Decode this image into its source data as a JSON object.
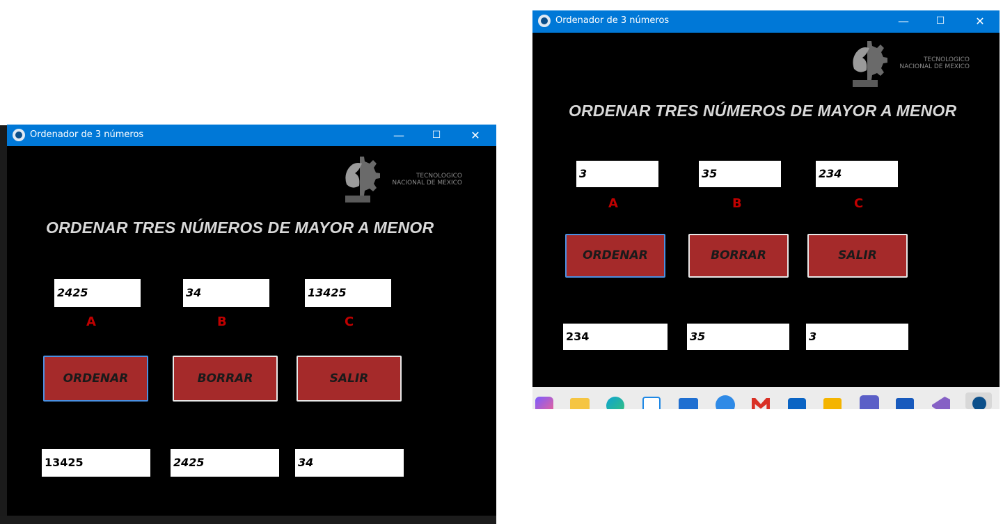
{
  "left_window": {
    "title": "Ordenador de 3 números",
    "logo_line1": "TECNOLOGICO",
    "logo_line2": "NACIONAL DE MEXICO",
    "heading": "ORDENAR TRES NÚMEROS DE MAYOR A MENOR",
    "inputs": {
      "a": "2425",
      "b": "34",
      "c": "13425"
    },
    "labels": {
      "a": "A",
      "b": "B",
      "c": "C"
    },
    "buttons": {
      "ordenar": "ORDENAR",
      "borrar": "BORRAR",
      "salir": "SALIR"
    },
    "results": [
      "13425",
      "2425",
      "34"
    ]
  },
  "right_window": {
    "title": "Ordenador de 3 números",
    "logo_line1": "TECNOLOGICO",
    "logo_line2": "NACIONAL DE MEXICO",
    "heading": "ORDENAR TRES NÚMEROS DE MAYOR A MENOR",
    "inputs": {
      "a": "3",
      "b": "35",
      "c": "234"
    },
    "labels": {
      "a": "A",
      "b": "B",
      "c": "C"
    },
    "buttons": {
      "ordenar": "ORDENAR",
      "borrar": "BORRAR",
      "salir": "SALIR"
    },
    "results": [
      "234",
      "35",
      "3"
    ]
  },
  "window_controls": {
    "minimize": "—",
    "maximize": "☐",
    "close": "✕"
  },
  "colors": {
    "titlebar": "#0078d7",
    "button_bg": "#a52a2a",
    "label_red": "#c00000"
  },
  "taskbar_icons": [
    "copilot-icon",
    "file-explorer-icon",
    "edge-icon",
    "store-icon",
    "photos-icon",
    "chat-icon",
    "gmail-icon",
    "outlook-icon",
    "powerpoint-icon",
    "teams-icon",
    "word-icon",
    "visual-studio-icon",
    "app-icon"
  ]
}
